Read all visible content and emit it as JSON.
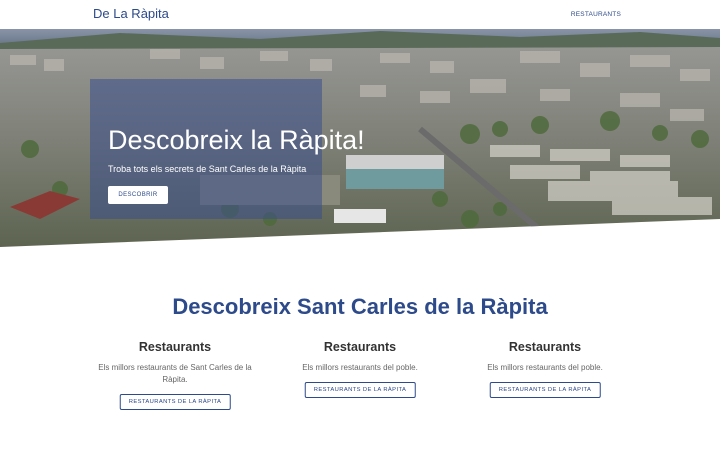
{
  "nav": {
    "brand": "De La Ràpita",
    "link": "RESTAURANTS"
  },
  "hero": {
    "title": "Descobreix la Ràpita!",
    "subtitle": "Troba tots els secrets de Sant Carles de la Ràpita",
    "button": "DESCOBRIR"
  },
  "section": {
    "title": "Descobreix Sant Carles de la Ràpita",
    "cards": [
      {
        "heading": "Restaurants",
        "text": "Els millors restaurants de Sant Carles de la Ràpita.",
        "button": "RESTAURANTS DE LA RÀPITA"
      },
      {
        "heading": "Restaurants",
        "text": "Els millors restaurants del poble.",
        "button": "RESTAURANTS DE LA RÀPITA"
      },
      {
        "heading": "Restaurants",
        "text": "Els millors restaurants del poble.",
        "button": "RESTAURANTS DE LA RÀPITA"
      }
    ]
  },
  "colors": {
    "accent": "#2d4a8a",
    "hero_overlay": "#3a4f8c"
  }
}
